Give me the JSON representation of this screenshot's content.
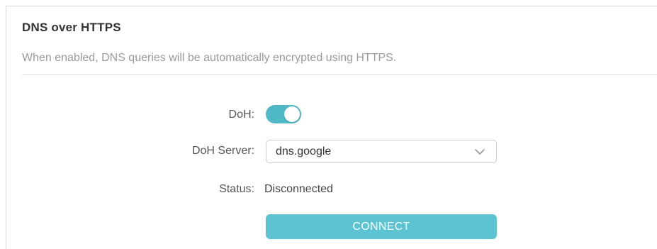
{
  "section": {
    "title": "DNS over HTTPS",
    "description": "When enabled, DNS queries will be automatically encrypted using HTTPS."
  },
  "doh": {
    "label": "DoH:",
    "enabled": true,
    "toggle_color": "#4fb9c8"
  },
  "server": {
    "label": "DoH Server:",
    "value": "dns.google",
    "icon": "chevron-down-icon"
  },
  "status": {
    "label": "Status:",
    "value": "Disconnected"
  },
  "connect": {
    "label": "CONNECT",
    "color": "#5cc3d2"
  }
}
